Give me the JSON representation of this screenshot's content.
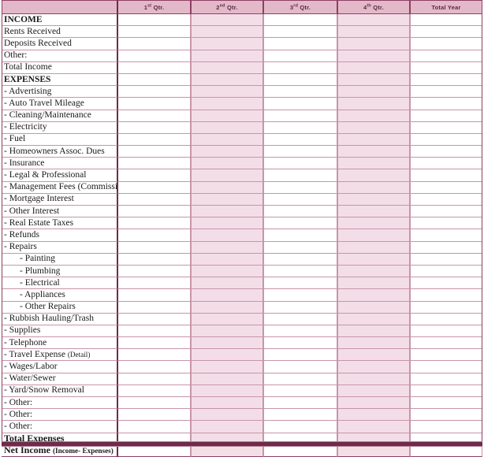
{
  "header": {
    "corner_label": "",
    "columns": [
      {
        "name": "q1",
        "label": "1",
        "ordinal": "st",
        "suffix": " Qtr.",
        "shaded": false
      },
      {
        "name": "q2",
        "label": "2",
        "ordinal": "nd",
        "suffix": " Qtr.",
        "shaded": true
      },
      {
        "name": "q3",
        "label": "3",
        "ordinal": "rd",
        "suffix": " Qtr.",
        "shaded": false
      },
      {
        "name": "q4",
        "label": "4",
        "ordinal": "th",
        "suffix": " Qtr.",
        "shaded": true
      },
      {
        "name": "total-year",
        "label": "Total Year",
        "ordinal": "",
        "suffix": "",
        "shaded": false
      }
    ]
  },
  "colors": {
    "header_fill": "#e3b9c9",
    "shaded_column": "#f3dee7",
    "rule": "#c795aa",
    "heavy_rule": "#6e2b4a",
    "text": "#1a1a1a",
    "header_text": "#5d2840"
  },
  "rows": [
    {
      "label": "INCOME",
      "style": "section",
      "indent": 0
    },
    {
      "label": "Rents Received",
      "style": "item",
      "indent": 0
    },
    {
      "label": "Deposits Received",
      "style": "item",
      "indent": 0
    },
    {
      "label": "Other:",
      "style": "item",
      "indent": 0
    },
    {
      "label": "Total Income",
      "style": "item",
      "indent": 0
    },
    {
      "label": "EXPENSES",
      "style": "section",
      "indent": 0
    },
    {
      "label": "- Advertising",
      "style": "item",
      "indent": 0
    },
    {
      "label": "- Auto Travel Mileage",
      "style": "item",
      "indent": 0
    },
    {
      "label": "- Cleaning/Maintenance",
      "style": "item",
      "indent": 0
    },
    {
      "label": "- Electricity",
      "style": "item",
      "indent": 0
    },
    {
      "label": "- Fuel",
      "style": "item",
      "indent": 0
    },
    {
      "label": "- Homeowners Assoc. Dues",
      "style": "item",
      "indent": 0
    },
    {
      "label": "- Insurance",
      "style": "item",
      "indent": 0
    },
    {
      "label": "- Legal & Professional",
      "style": "item",
      "indent": 0
    },
    {
      "label": "- Management Fees (Commissions)",
      "style": "item",
      "indent": 0
    },
    {
      "label": "- Mortgage Interest",
      "style": "item",
      "indent": 0
    },
    {
      "label": "- Other Interest",
      "style": "item",
      "indent": 0
    },
    {
      "label": "- Real Estate Taxes",
      "style": "item",
      "indent": 0
    },
    {
      "label": "- Refunds",
      "style": "item",
      "indent": 0
    },
    {
      "label": "- Repairs",
      "style": "item",
      "indent": 0
    },
    {
      "label": "- Painting",
      "style": "item",
      "indent": 1
    },
    {
      "label": "- Plumbing",
      "style": "item",
      "indent": 1
    },
    {
      "label": "- Electrical",
      "style": "item",
      "indent": 1
    },
    {
      "label": "- Appliances",
      "style": "item",
      "indent": 1
    },
    {
      "label": "- Other Repairs",
      "style": "item",
      "indent": 1
    },
    {
      "label": "- Rubbish Hauling/Trash",
      "style": "item",
      "indent": 0
    },
    {
      "label": "- Supplies",
      "style": "item",
      "indent": 0
    },
    {
      "label": "- Telephone",
      "style": "item",
      "indent": 0
    },
    {
      "label": "- Travel Expense ",
      "style": "item",
      "indent": 0,
      "note": "(Detail)"
    },
    {
      "label": "- Wages/Labor",
      "style": "item",
      "indent": 0
    },
    {
      "label": "- Water/Sewer",
      "style": "item",
      "indent": 0
    },
    {
      "label": "- Yard/Snow Removal",
      "style": "item",
      "indent": 0
    },
    {
      "label": "- Other:",
      "style": "item",
      "indent": 0
    },
    {
      "label": "- Other:",
      "style": "item",
      "indent": 0
    },
    {
      "label": "- Other:",
      "style": "item",
      "indent": 0
    },
    {
      "label": "Total Expenses",
      "style": "total",
      "indent": 0
    },
    {
      "label": "Net Income ",
      "style": "total",
      "indent": 0,
      "note": "(Income- Expenses)"
    }
  ]
}
